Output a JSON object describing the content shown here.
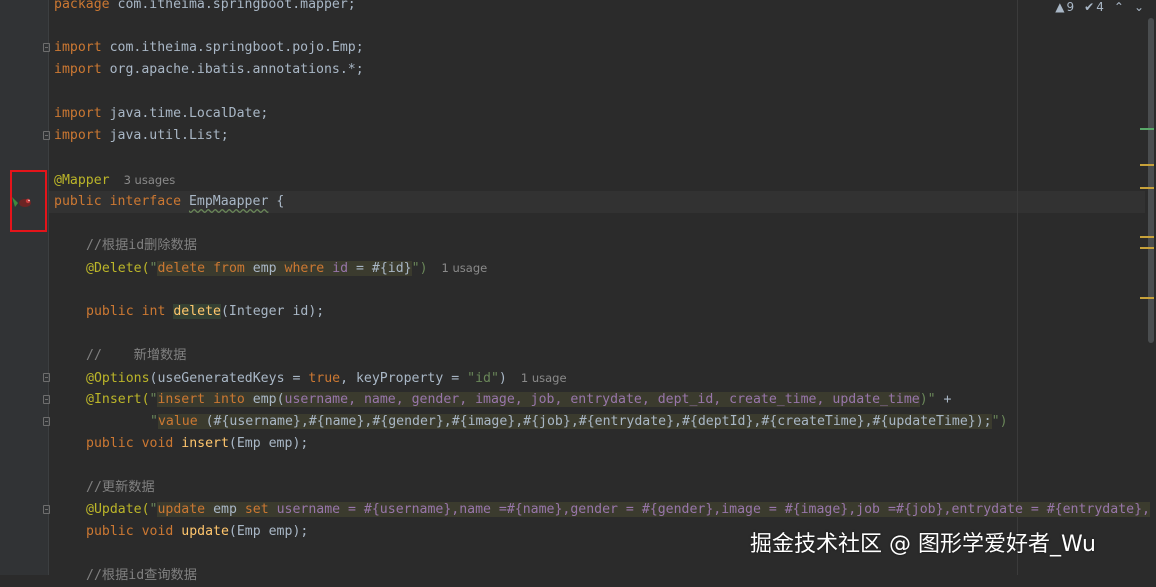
{
  "status": {
    "warnings": "9",
    "checks": "4",
    "up_arrow": "⌃",
    "down_arrow": "⌄"
  },
  "code": {
    "package_kw": "package",
    "package_name": " com.itheima.springboot.mapper;",
    "import_kw": "import",
    "import_1": " com.itheima.springboot.pojo.Emp;",
    "import_2": " org.apache.ibatis.annotations.*;",
    "import_3": " java.time.LocalDate;",
    "import_4": " java.util.List;",
    "mapper_ann": "@Mapper",
    "mapper_usages": "3 usages",
    "public_kw": "public",
    "interface_kw": " interface ",
    "interface_name": "EmpMaapper",
    "open_brace": " {",
    "comment_delete": "//根据id删除数据",
    "delete_ann": "@Delete(",
    "delete_sql_q": "\"",
    "delete_sql_kw1": "delete",
    "delete_sql_mid1": " ",
    "delete_sql_kw2": "from",
    "delete_sql_mid2": " emp ",
    "delete_sql_kw3": "where",
    "delete_sql_mid3": " ",
    "delete_sql_id": "id",
    "delete_sql_tail": " = #{id}",
    "delete_close": "\")",
    "delete_usage": "1 usage",
    "delete_sig_pre": "public",
    "delete_sig_type": " int ",
    "delete_sig_name": "delete",
    "delete_sig_params": "(Integer id);",
    "comment_insert": "//    新增数据",
    "options_ann": "@Options",
    "options_args_1": "(useGeneratedKeys = ",
    "options_true": "true",
    "options_args_2": ", keyProperty = ",
    "options_str": "\"id\"",
    "options_close": ")",
    "options_usage": "1 usage",
    "insert_ann": "@Insert(",
    "insert_q": "\"",
    "insert_kw1": "insert",
    "insert_mid1": " ",
    "insert_kw2": "into",
    "insert_mid2": " emp(",
    "insert_cols": "username, name, gender, image, job, entrydate, dept_id, create_time, update_time",
    "insert_close1": ")\"",
    "insert_plus": " +",
    "insert_line2_q": "\"",
    "insert_line2_kw": "value",
    "insert_line2_vals": " (#{username},#{name},#{gender},#{image},#{job},#{entrydate},#{deptId},#{createTime},#{updateTime});",
    "insert_line2_close": "\")",
    "insert_sig_pre": "public",
    "insert_sig_type": " void ",
    "insert_sig_name": "insert",
    "insert_sig_params": "(Emp emp);",
    "comment_update": "//更新数据",
    "update_ann": "@Update(",
    "update_q": "\"",
    "update_kw1": "update",
    "update_mid1": " emp ",
    "update_kw2": "set",
    "update_body": " username = #{username},name =#{name},gender = #{gender},image = #{image},job =#{job},entrydate = #{entrydate},",
    "update_sig_pre": "public",
    "update_sig_type": " void ",
    "update_sig_name": "update",
    "update_sig_params": "(Emp emp);",
    "comment_query": "//根据id查询数据"
  },
  "watermark": "掘金技术社区 @ 图形学爱好者_Wu"
}
